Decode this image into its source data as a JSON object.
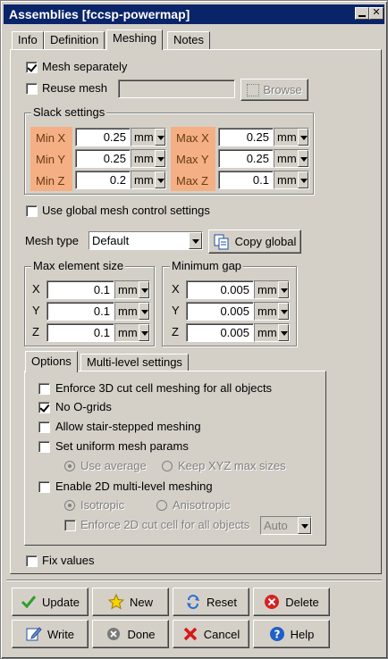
{
  "window": {
    "title": "Assemblies [fccsp-powermap]"
  },
  "tabs": [
    {
      "label": "Info"
    },
    {
      "label": "Definition"
    },
    {
      "label": "Meshing"
    },
    {
      "label": "Notes"
    }
  ],
  "mesh_separately": {
    "label": "Mesh separately",
    "checked": true
  },
  "reuse_mesh": {
    "label": "Reuse mesh",
    "checked": false,
    "value": "",
    "browse_label": "Browse"
  },
  "slack": {
    "title": "Slack settings",
    "rows": [
      {
        "min_label": "Min X",
        "min_value": "0.25",
        "min_unit": "mm",
        "max_label": "Max X",
        "max_value": "0.25",
        "max_unit": "mm"
      },
      {
        "min_label": "Min Y",
        "min_value": "0.25",
        "min_unit": "mm",
        "max_label": "Max Y",
        "max_value": "0.25",
        "max_unit": "mm"
      },
      {
        "min_label": "Min Z",
        "min_value": "0.2",
        "min_unit": "mm",
        "max_label": "Max Z",
        "max_value": "0.1",
        "max_unit": "mm"
      }
    ]
  },
  "global_mesh": {
    "label": "Use global mesh control settings",
    "checked": false
  },
  "mesh_type": {
    "label": "Mesh type",
    "value": "Default",
    "copy_label": "Copy global"
  },
  "max_element_size": {
    "title": "Max element size",
    "rows": [
      {
        "axis": "X",
        "value": "0.1",
        "unit": "mm"
      },
      {
        "axis": "Y",
        "value": "0.1",
        "unit": "mm"
      },
      {
        "axis": "Z",
        "value": "0.1",
        "unit": "mm"
      }
    ]
  },
  "minimum_gap": {
    "title": "Minimum gap",
    "rows": [
      {
        "axis": "X",
        "value": "0.005",
        "unit": "mm"
      },
      {
        "axis": "Y",
        "value": "0.005",
        "unit": "mm"
      },
      {
        "axis": "Z",
        "value": "0.005",
        "unit": "mm"
      }
    ]
  },
  "subtabs": [
    {
      "label": "Options"
    },
    {
      "label": "Multi-level settings"
    }
  ],
  "options": {
    "enforce_3d": "Enforce 3D cut cell meshing for all objects",
    "no_ogrids": "No O-grids",
    "stair_stepped": "Allow stair-stepped meshing",
    "uniform": "Set uniform mesh params",
    "use_average": "Use average",
    "keep_xyz": "Keep XYZ max sizes",
    "enable_2d": "Enable 2D multi-level meshing",
    "isotropic": "Isotropic",
    "anisotropic": "Anisotropic",
    "enforce_2d": "Enforce 2D cut cell for all objects",
    "enforce_2d_value": "Auto"
  },
  "fix_values": {
    "label": "Fix values",
    "checked": false
  },
  "buttons": {
    "update": "Update",
    "new": "New",
    "reset": "Reset",
    "delete": "Delete",
    "write": "Write",
    "done": "Done",
    "cancel": "Cancel",
    "help": "Help"
  }
}
